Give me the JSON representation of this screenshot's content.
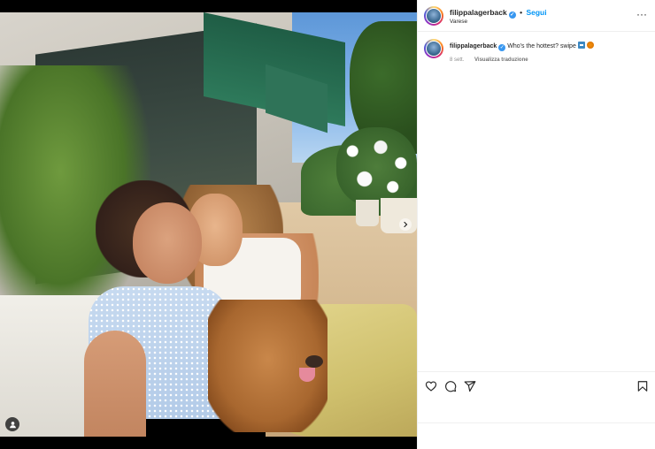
{
  "post": {
    "username": "filippalagerback",
    "location": "Varese",
    "follow_label": "Segui",
    "separator": "•",
    "more_label": "···"
  },
  "caption": {
    "username": "filippalagerback",
    "text": "Who's the hottest? swipe",
    "age": "8 sett.",
    "translate_label": "Visualizza traduzione"
  },
  "icons": {
    "verified": "verified-badge-icon",
    "like": "heart-icon",
    "comment": "comment-icon",
    "share": "send-icon",
    "save": "bookmark-icon",
    "next": "chevron-right-icon",
    "tagged": "user-tag-icon",
    "emoji_arrow": "right-arrow-emoji",
    "emoji_hotdog": "hotdog-emoji"
  },
  "colors": {
    "follow": "#0095f6",
    "verified": "#3897f0",
    "text": "#262626",
    "muted": "#8e8e8e"
  }
}
